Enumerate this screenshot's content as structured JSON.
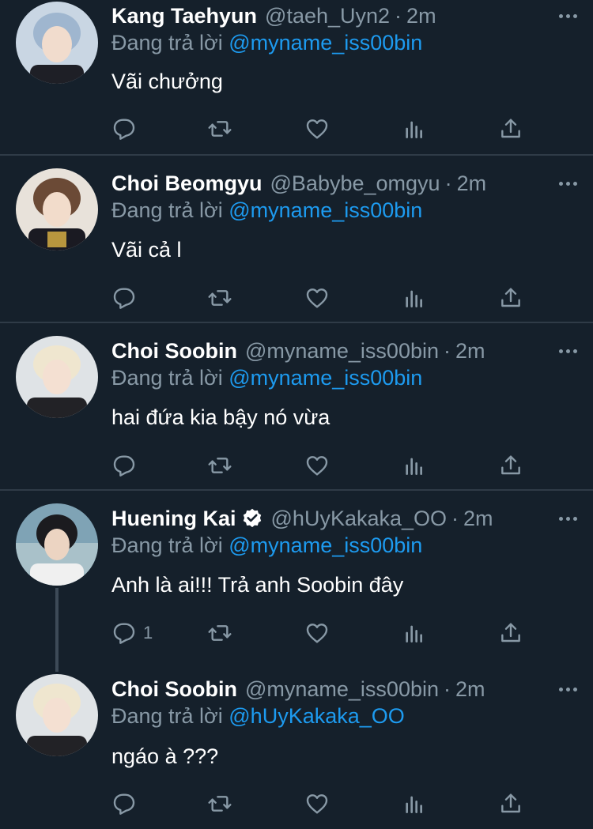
{
  "tweets": [
    {
      "name": "Kang Taehyun",
      "handle": "@taeh_Uyn2",
      "separator": "·",
      "time": "2m",
      "reply_prefix": "Đang trả lời ",
      "reply_mention": "@myname_iss00bin",
      "text": "Vãi chưởng",
      "reply_count": "",
      "verified": false
    },
    {
      "name": "Choi Beomgyu",
      "handle": "@Babybe_omgyu",
      "separator": "·",
      "time": "2m",
      "reply_prefix": "Đang trả lời ",
      "reply_mention": "@myname_iss00bin",
      "text": "Vãi cả l",
      "reply_count": "",
      "verified": false
    },
    {
      "name": "Choi Soobin",
      "handle": "@myname_iss00bin",
      "separator": "·",
      "time": "2m",
      "reply_prefix": "Đang trả lời ",
      "reply_mention": "@myname_iss00bin",
      "text": "hai đứa kia bậy nó vừa",
      "reply_count": "",
      "verified": false
    },
    {
      "name": "Huening Kai",
      "handle": "@hUyKakaka_OO",
      "separator": "·",
      "time": "2m",
      "reply_prefix": "Đang trả lời ",
      "reply_mention": "@myname_iss00bin",
      "text": "Anh là ai!!! Trả anh Soobin đây",
      "reply_count": "1",
      "verified": true
    },
    {
      "name": "Choi Soobin",
      "handle": "@myname_iss00bin",
      "separator": "·",
      "time": "2m",
      "reply_prefix": "Đang trả lời ",
      "reply_mention": "@hUyKakaka_OO",
      "text": "ngáo à ???",
      "reply_count": "",
      "verified": false
    }
  ],
  "icons": {
    "reply": "reply-icon",
    "retweet": "retweet-icon",
    "like": "heart-icon",
    "analytics": "analytics-icon",
    "share": "share-icon",
    "more": "more-icon",
    "verified": "verified-badge-icon"
  },
  "colors": {
    "background": "#15202b",
    "divider": "#2f3b47",
    "muted": "#8899a6",
    "link": "#1d9bf0",
    "text": "#ffffff"
  }
}
